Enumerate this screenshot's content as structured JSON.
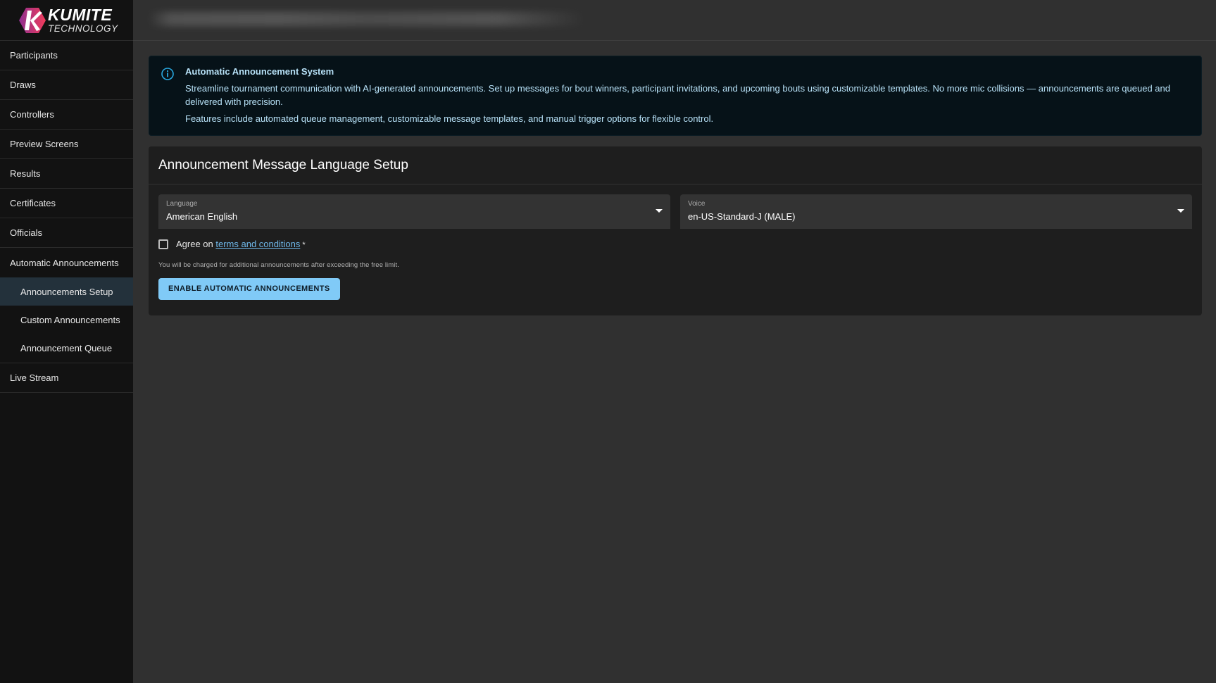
{
  "brand": {
    "title": "KUMITE",
    "subtitle": "TECHNOLOGY",
    "colors": {
      "gradient_start": "#8e2f8f",
      "gradient_end": "#f23c5b"
    }
  },
  "header": {
    "title_blurred": true
  },
  "sidebar": {
    "items": [
      {
        "label": "Participants"
      },
      {
        "label": "Draws"
      },
      {
        "label": "Controllers"
      },
      {
        "label": "Preview Screens"
      },
      {
        "label": "Results"
      },
      {
        "label": "Certificates"
      },
      {
        "label": "Officials"
      },
      {
        "label": "Automatic Announcements",
        "children": [
          {
            "label": "Announcements Setup",
            "active": true
          },
          {
            "label": "Custom Announcements"
          },
          {
            "label": "Announcement Queue"
          }
        ]
      },
      {
        "label": "Live Stream"
      }
    ]
  },
  "alert": {
    "icon": "info-icon",
    "title": "Automatic Announcement System",
    "paragraphs": [
      "Streamline tournament communication with AI-generated announcements. Set up messages for bout winners, participant invitations, and upcoming bouts using customizable templates. No more mic collisions — announcements are queued and delivered with precision.",
      "Features include automated queue management, customizable message templates, and manual trigger options for flexible control."
    ],
    "color": "#b7e1f7"
  },
  "setup": {
    "title": "Announcement Message Language Setup",
    "language": {
      "label": "Language",
      "value": "American English"
    },
    "voice": {
      "label": "Voice",
      "value": "en-US-Standard-J (MALE)"
    },
    "agree": {
      "prefix": "Agree on",
      "link": "terms and conditions",
      "required_mark": "*",
      "checked": false
    },
    "helper": "You will be charged for additional announcements after exceeding the free limit.",
    "button_label": "ENABLE AUTOMATIC ANNOUNCEMENTS",
    "accent": "#80caf7"
  }
}
